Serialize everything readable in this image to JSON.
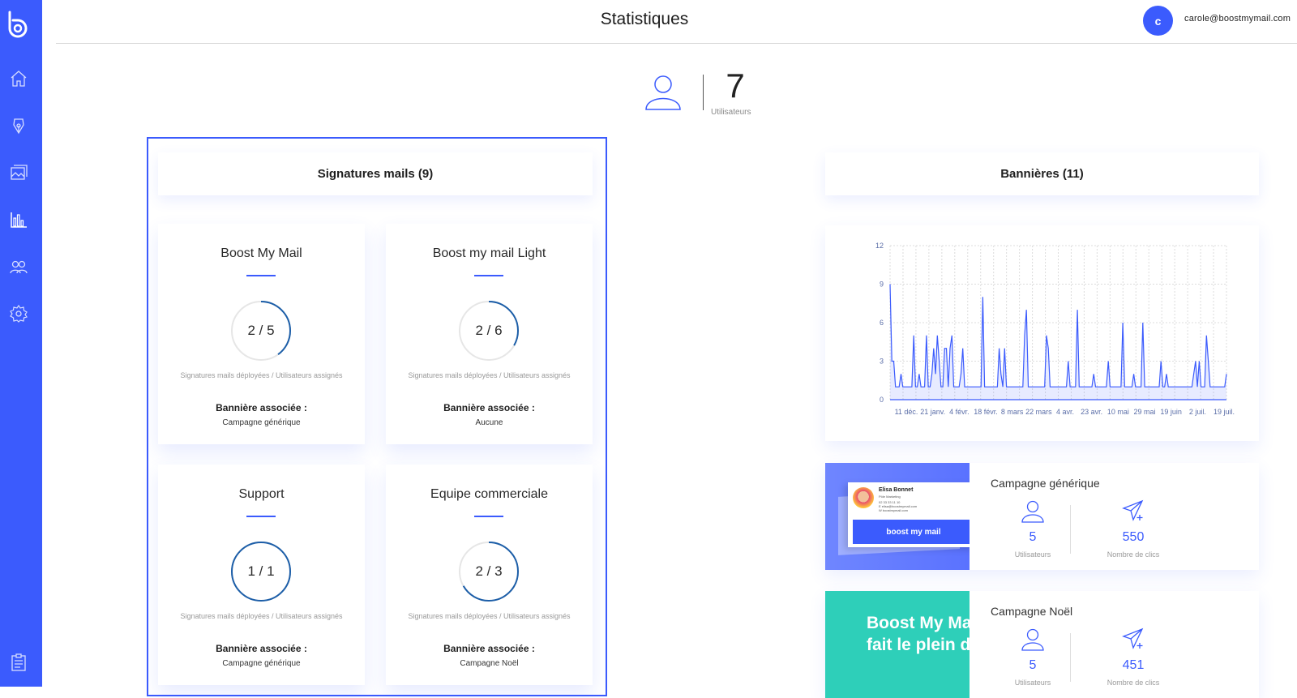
{
  "header": {
    "title": "Statistiques",
    "avatar_initial": "c",
    "email": "carole@boostmymail.com"
  },
  "sidebar": {
    "items": [
      {
        "icon": "home-icon"
      },
      {
        "icon": "pen-icon"
      },
      {
        "icon": "image-icon"
      },
      {
        "icon": "chart-icon"
      },
      {
        "icon": "users-icon"
      },
      {
        "icon": "gear-icon"
      },
      {
        "icon": "clipboard-icon"
      }
    ],
    "accent": "#3b5bfd"
  },
  "users_summary": {
    "count": "7",
    "label": "Utilisateurs"
  },
  "signatures": {
    "title": "Signatures mails (9)",
    "caption": "Signatures mails déployées / Utilisateurs assignés",
    "banner_label": "Bannière associée :",
    "cards": [
      {
        "name": "Boost My Mail",
        "ratio": "2 / 5",
        "deployed": 2,
        "assigned": 5,
        "banner": "Campagne générique"
      },
      {
        "name": "Boost my mail Light",
        "ratio": "2 / 6",
        "deployed": 2,
        "assigned": 6,
        "banner": "Aucune"
      },
      {
        "name": "Support",
        "ratio": "1 / 1",
        "deployed": 1,
        "assigned": 1,
        "banner": "Campagne générique"
      },
      {
        "name": "Equipe commerciale",
        "ratio": "2 / 3",
        "deployed": 2,
        "assigned": 3,
        "banner": "Campagne Noël"
      }
    ]
  },
  "banners": {
    "title": "Bannières (11)",
    "campaigns": [
      {
        "name": "Campagne générique",
        "users": "5",
        "users_label": "Utilisateurs",
        "clicks": "550",
        "clicks_label": "Nombre de clics",
        "thumb": {
          "person": "Elisa Bonnet",
          "role": "Pôle Marketing",
          "phone": "02 33 33 11 10",
          "mail": "E elisa@boostmymail.com",
          "site": "W boostmymail.com",
          "brand": "boost my mail"
        }
      },
      {
        "name": "Campagne Noël",
        "users": "5",
        "users_label": "Utilisateurs",
        "clicks": "451",
        "clicks_label": "Nombre de clics",
        "thumb": {
          "line1": "Boost My Ma",
          "line2": "fait le plein d"
        }
      }
    ]
  },
  "chart_data": {
    "type": "line",
    "ylim": [
      0,
      12
    ],
    "yticks": [
      0,
      3,
      6,
      9,
      12
    ],
    "xtick_labels": [
      "11 déc.",
      "21 janv.",
      "4 févr.",
      "18 févr.",
      "8 mars",
      "22 mars",
      "4 avr.",
      "23 avr.",
      "10 mai",
      "29 mai",
      "19 juin",
      "2 juil.",
      "19 juil."
    ],
    "grid": true,
    "series": [
      {
        "values": [
          9,
          3,
          3,
          1,
          1,
          1,
          2,
          1,
          1,
          1,
          1,
          1,
          1,
          5,
          1,
          1,
          2,
          1,
          1,
          1,
          5,
          1,
          1,
          2,
          4,
          2,
          5,
          3,
          1,
          1,
          4,
          4,
          1,
          4,
          5,
          1,
          1,
          1,
          1,
          2,
          4,
          1,
          1,
          1,
          1,
          1,
          1,
          1,
          1,
          1,
          1,
          8,
          1,
          1,
          1,
          1,
          1,
          1,
          1,
          1,
          4,
          2,
          1,
          4,
          1,
          1,
          1,
          1,
          1,
          1,
          1,
          1,
          1,
          1,
          5,
          7,
          1,
          1,
          1,
          1,
          1,
          1,
          1,
          1,
          1,
          1,
          5,
          4,
          1,
          1,
          1,
          1,
          1,
          1,
          1,
          1,
          1,
          1,
          3,
          1,
          1,
          1,
          1,
          7,
          1,
          1,
          1,
          1,
          1,
          1,
          1,
          1,
          2,
          1,
          1,
          1,
          1,
          1,
          1,
          1,
          3,
          1,
          1,
          1,
          1,
          1,
          1,
          1,
          6,
          1,
          1,
          1,
          1,
          1,
          2,
          1,
          1,
          1,
          1,
          6,
          1,
          1,
          1,
          1,
          1,
          1,
          1,
          1,
          1,
          3,
          1,
          1,
          2,
          1,
          1,
          1,
          1,
          1,
          1,
          1,
          1,
          1,
          1,
          1,
          1,
          1,
          1,
          2,
          3,
          1,
          3,
          1,
          1,
          1,
          5,
          3,
          1,
          1,
          1,
          1,
          1,
          1,
          1,
          1,
          1,
          2
        ]
      }
    ]
  }
}
